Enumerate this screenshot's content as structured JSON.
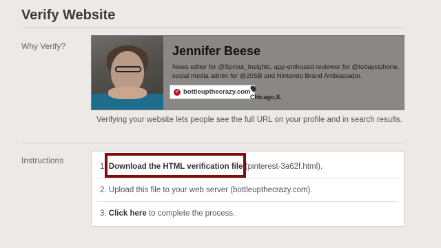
{
  "page": {
    "title": "Verify Website"
  },
  "why": {
    "label": "Why Verify?",
    "profile": {
      "name": "Jennifer Beese",
      "bio": "News editor for @Sprout_Insights, app-enthused reviewer for @todaysiphone, social media admin for @20SB and Nintendo Brand Ambassador.",
      "website": "bottleupthecrazy.com",
      "location": "Chicago,IL"
    },
    "description": "Verifying your website lets people see the full URL on your profile and in search results."
  },
  "instructions": {
    "label": "Instructions",
    "step1": {
      "number": "1.",
      "link": "Download the HTML verification file",
      "suffix": " (pinterest-3a62f.html)."
    },
    "step2": {
      "text": "2. Upload this file to your web server (bottleupthecrazy.com)."
    },
    "step3": {
      "number": "3.",
      "link": "Click here",
      "suffix": " to complete the process."
    }
  },
  "colors": {
    "highlight_border": "#7e0d0d",
    "verified_badge": "#b5182a"
  }
}
